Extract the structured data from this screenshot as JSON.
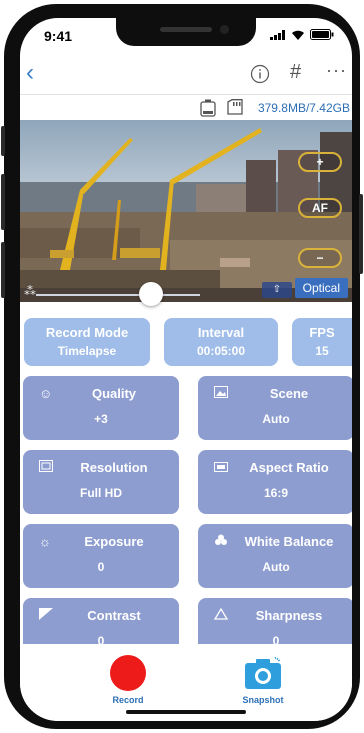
{
  "status_bar": {
    "time": "9:41"
  },
  "nav": {
    "back_glyph": "‹",
    "grid_glyph": "#",
    "more_glyph": "···"
  },
  "storage": {
    "text": "379.8MB/7.42GB"
  },
  "preview": {
    "controls": {
      "plus": "+",
      "af": "AF",
      "minus": "−"
    },
    "optical_label": "Optical",
    "zoom_glyph": "⇧",
    "zoom_slider_level": 0.7
  },
  "top_settings": [
    {
      "title": "Record Mode",
      "value": "Timelapse"
    },
    {
      "title": "Interval",
      "value": "00:05:00"
    },
    {
      "title": "FPS",
      "value": "15"
    }
  ],
  "settings": [
    {
      "label": "Quality",
      "value": "+3",
      "icon": "smiley-icon"
    },
    {
      "label": "Scene",
      "value": "Auto",
      "icon": "scene-icon"
    },
    {
      "label": "Resolution",
      "value": "Full HD",
      "icon": "resolution-icon"
    },
    {
      "label": "Aspect Ratio",
      "value": "16:9",
      "icon": "aspect-ratio-icon"
    },
    {
      "label": "Exposure",
      "value": "0",
      "icon": "exposure-icon"
    },
    {
      "label": "White Balance",
      "value": "Auto",
      "icon": "white-balance-icon"
    },
    {
      "label": "Contrast",
      "value": "0",
      "icon": "contrast-icon"
    },
    {
      "label": "Sharpness",
      "value": "0",
      "icon": "sharpness-icon"
    }
  ],
  "bottom": {
    "record_label": "Record",
    "snapshot_label": "Snapshot"
  },
  "colors": {
    "accent": "#2d6fb5",
    "card": "#8e9dd0",
    "top_card": "#9fbde8",
    "record": "#ee1b1b",
    "snapshot": "#2e9fdc"
  }
}
